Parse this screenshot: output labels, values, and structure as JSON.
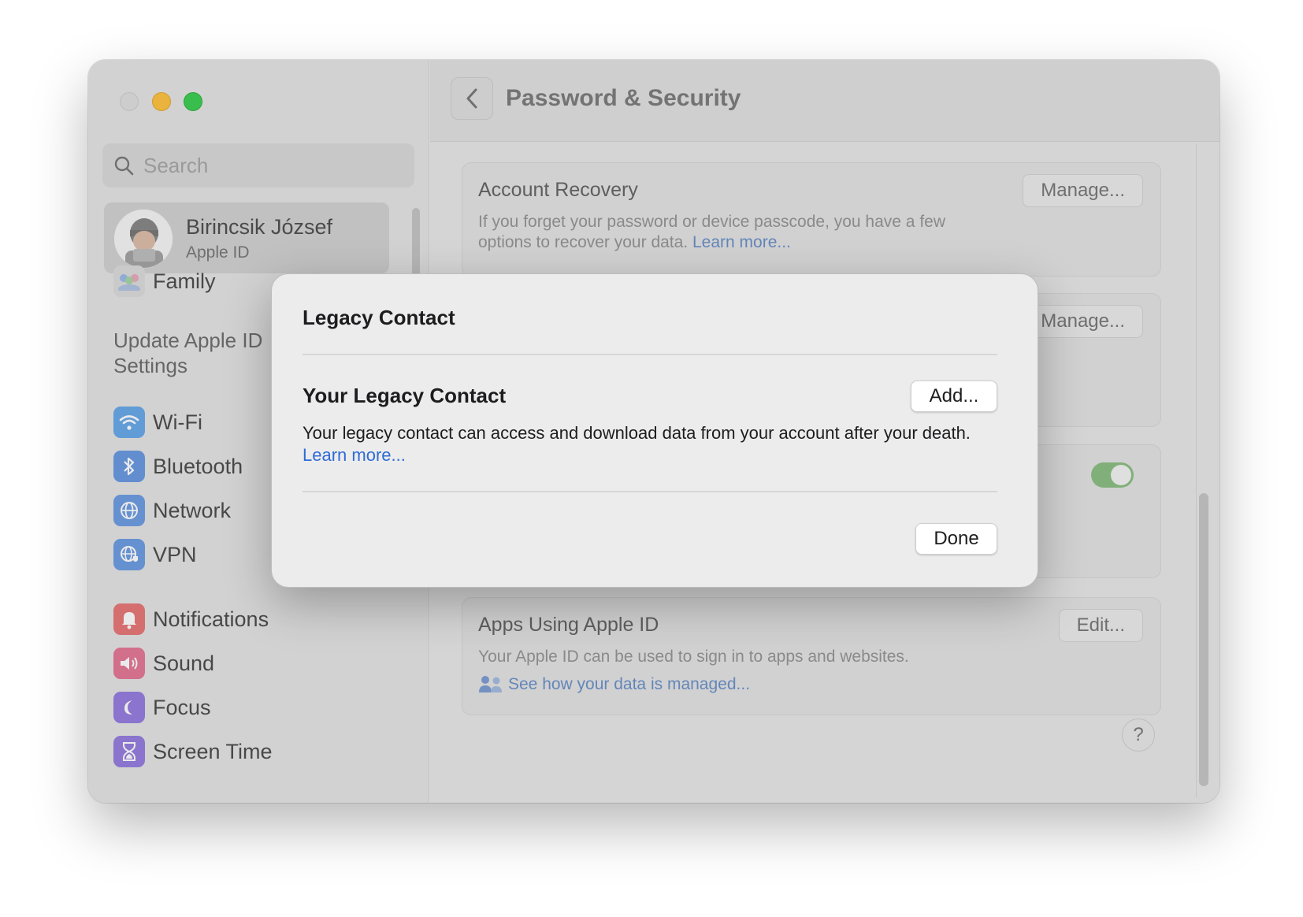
{
  "search": {
    "placeholder": "Search"
  },
  "profile": {
    "name": "Birincsik József",
    "subtitle": "Apple ID"
  },
  "sidebar": {
    "family": "Family",
    "update_line1": "Update Apple ID",
    "update_line2": "Settings",
    "items": [
      {
        "label": "Wi-Fi",
        "icon": "wifi-icon",
        "color": "#5aa0e8"
      },
      {
        "label": "Bluetooth",
        "icon": "bluetooth-icon",
        "color": "#5a8fe0"
      },
      {
        "label": "Network",
        "icon": "globe-icon",
        "color": "#5f93e0"
      },
      {
        "label": "VPN",
        "icon": "vpn-globe-icon",
        "color": "#5f93e0"
      },
      {
        "label": "Notifications",
        "icon": "bell-icon",
        "color": "#e66a6a"
      },
      {
        "label": "Sound",
        "icon": "speaker-icon",
        "color": "#e2698b"
      },
      {
        "label": "Focus",
        "icon": "moon-icon",
        "color": "#8a6fdc"
      },
      {
        "label": "Screen Time",
        "icon": "hourglass-icon",
        "color": "#8a6fdc"
      }
    ]
  },
  "header": {
    "title": "Password & Security"
  },
  "cards": {
    "account_recovery": {
      "title": "Account Recovery",
      "text": "If you forget your password or device passcode, you have a few options to recover your data.",
      "link": "Learn more...",
      "button": "Manage..."
    },
    "legacy": {
      "button": "Manage..."
    },
    "apps": {
      "title": "Apps Using Apple ID",
      "text": "Your Apple ID can be used to sign in to apps and websites.",
      "link": "See how your data is managed...",
      "button": "Edit..."
    },
    "help": "?"
  },
  "dialog": {
    "title": "Legacy Contact",
    "section_title": "Your Legacy Contact",
    "add_button": "Add...",
    "text": "Your legacy contact can access and download data from your account after your death.",
    "link": "Learn more...",
    "done_button": "Done"
  },
  "colors": {
    "accent": "#2f6bd6",
    "toggle_on": "#7fb876"
  }
}
